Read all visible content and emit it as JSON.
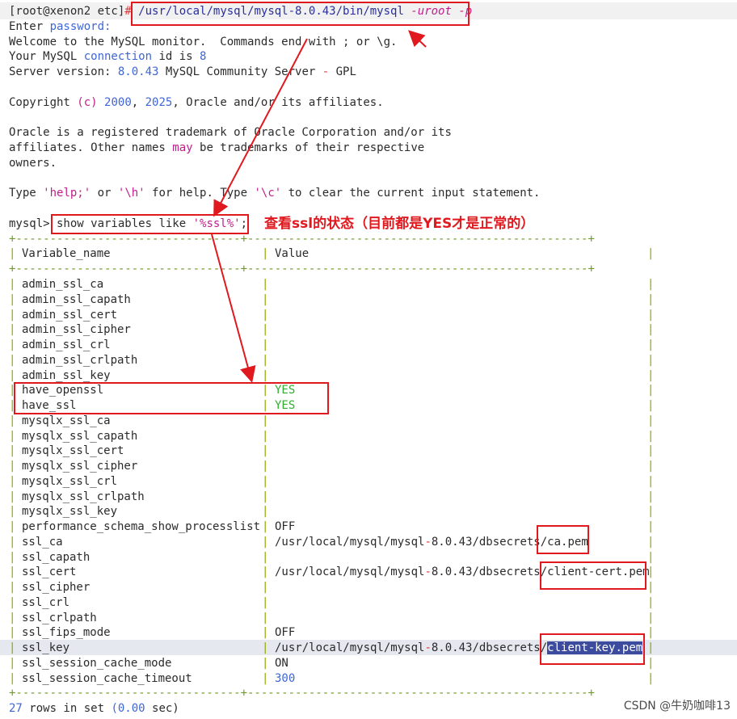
{
  "terminal": {
    "prompt": "[root@xenon2 etc]",
    "prompt_hash": "#",
    "command": "/usr/local/mysql/mysql-8.0.43/bin/mysql",
    "command_opts": "-uroot -p",
    "enter_password_a": "Enter ",
    "enter_password_b": "password:",
    "welcome": "Welcome to the MySQL monitor.  Commands end with ; or \\g.",
    "conn_a": "Your MySQL ",
    "conn_b": "connection",
    "conn_c": " id is ",
    "conn_id": "8",
    "server_a": "Server version: ",
    "server_ver": "8.0.43",
    "server_b": " MySQL Community Server ",
    "server_dash": "-",
    "server_c": " GPL",
    "copyright_a": "Copyright ",
    "copyright_c": "(c)",
    "copyright_y1": "2000",
    "copyright_comma": ", ",
    "copyright_y2": "2025",
    "copyright_b": ", Oracle and/or its affiliates.",
    "oracle1": "Oracle is a registered trademark of Oracle Corporation and/or its",
    "oracle2_a": "affiliates. Other names ",
    "oracle2_may": "may",
    "oracle2_b": " be trademarks of their respective",
    "oracle3": "owners.",
    "help_a": "Type ",
    "help_help": "'help;'",
    "help_b": " or ",
    "help_h": "'\\h'",
    "help_c": " for help. Type ",
    "help_cc": "'\\c'",
    "help_d": " to clear the current input statement.",
    "mysql_prompt": "mysql>",
    "query_a": " show variables like ",
    "query_pat": "'%ssl%'",
    "query_b": ";",
    "border": "+---------------------------------+--------------------------------------------------+",
    "header_name": "Variable_name",
    "header_value": "Value",
    "footer_rows": "27",
    "footer_a": " rows in set ",
    "footer_time": "(0.00",
    "footer_b": " sec)"
  },
  "annotation": {
    "text": "查看ssl的状态（目前都是YES才是正常的）",
    "color": "#e0191f"
  },
  "watermark": "CSDN @牛奶咖啡13",
  "rows": [
    {
      "name": "admin_ssl_ca",
      "value": ""
    },
    {
      "name": "admin_ssl_capath",
      "value": ""
    },
    {
      "name": "admin_ssl_cert",
      "value": ""
    },
    {
      "name": "admin_ssl_cipher",
      "value": ""
    },
    {
      "name": "admin_ssl_crl",
      "value": ""
    },
    {
      "name": "admin_ssl_crlpath",
      "value": ""
    },
    {
      "name": "admin_ssl_key",
      "value": ""
    },
    {
      "name": "have_openssl",
      "value": "YES"
    },
    {
      "name": "have_ssl",
      "value": "YES"
    },
    {
      "name": "mysqlx_ssl_ca",
      "value": ""
    },
    {
      "name": "mysqlx_ssl_capath",
      "value": ""
    },
    {
      "name": "mysqlx_ssl_cert",
      "value": ""
    },
    {
      "name": "mysqlx_ssl_cipher",
      "value": ""
    },
    {
      "name": "mysqlx_ssl_crl",
      "value": ""
    },
    {
      "name": "mysqlx_ssl_crlpath",
      "value": ""
    },
    {
      "name": "mysqlx_ssl_key",
      "value": ""
    },
    {
      "name": "performance_schema_show_processlist",
      "value": "OFF"
    },
    {
      "name": "ssl_ca",
      "value": "/usr/local/mysql/mysql-8.0.43/dbsecrets/ca.pem"
    },
    {
      "name": "ssl_capath",
      "value": ""
    },
    {
      "name": "ssl_cert",
      "value": "/usr/local/mysql/mysql-8.0.43/dbsecrets/client-cert.pem"
    },
    {
      "name": "ssl_cipher",
      "value": ""
    },
    {
      "name": "ssl_crl",
      "value": ""
    },
    {
      "name": "ssl_crlpath",
      "value": ""
    },
    {
      "name": "ssl_fips_mode",
      "value": "OFF"
    },
    {
      "name": "ssl_key",
      "value": "/usr/local/mysql/mysql-8.0.43/dbsecrets/client-key.pem"
    },
    {
      "name": "ssl_session_cache_mode",
      "value": "ON"
    },
    {
      "name": "ssl_session_cache_timeout",
      "value": "300"
    }
  ]
}
